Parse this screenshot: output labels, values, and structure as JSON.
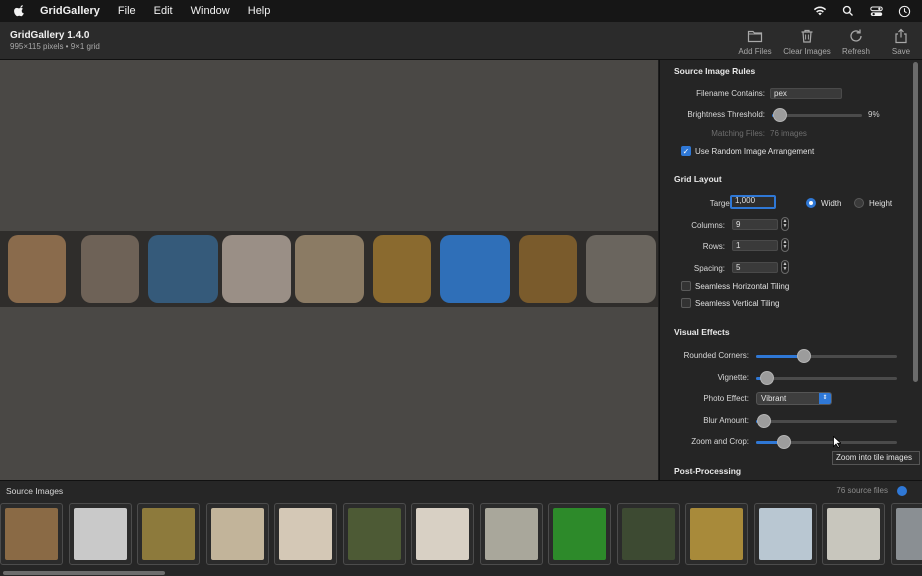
{
  "menubar": {
    "app_name": "GridGallery",
    "items": [
      "File",
      "Edit",
      "Window",
      "Help"
    ]
  },
  "window": {
    "title": "GridGallery 1.4.0",
    "subtitle": "995×115 pixels • 9×1 grid",
    "toolbar": {
      "add_files": "Add Files",
      "clear_images": "Clear Images",
      "refresh": "Refresh",
      "save": "Save"
    }
  },
  "grid_tiles": [
    {
      "icon": "fawn-photo",
      "color": "#8a6b4c"
    },
    {
      "icon": "kittens-photo",
      "color": "#6e6257"
    },
    {
      "icon": "chipmunk-photo",
      "color": "#355a7a"
    },
    {
      "icon": "bluebird-photo",
      "color": "#9a8f86"
    },
    {
      "icon": "hens-photo",
      "color": "#8b7b64"
    },
    {
      "icon": "deer-photo",
      "color": "#8a6a2f"
    },
    {
      "icon": "falcon-photo",
      "color": "#2f6fb8"
    },
    {
      "icon": "rooster-photo",
      "color": "#7a5b2c"
    },
    {
      "icon": "seal-photo",
      "color": "#6a655e"
    }
  ],
  "panel": {
    "source_rules": {
      "heading": "Source Image Rules",
      "filename_label": "Filename Contains:",
      "filename_value": "pex",
      "brightness_label": "Brightness Threshold:",
      "brightness_value": "9%",
      "brightness_level": 0.09,
      "matching_label": "Matching Files:",
      "matching_value": "76 images",
      "random_label": "Use Random Image Arrangement",
      "random_checked": true
    },
    "grid_layout": {
      "heading": "Grid Layout",
      "target_label": "Target Size:",
      "target_value": "1,000",
      "width_label": "Width",
      "height_label": "Height",
      "selected_dimension": "Width",
      "columns_label": "Columns:",
      "columns_value": "9",
      "rows_label": "Rows:",
      "rows_value": "1",
      "spacing_label": "Spacing:",
      "spacing_value": "5",
      "h_tiling_label": "Seamless Horizontal Tiling",
      "v_tiling_label": "Seamless Vertical Tiling"
    },
    "visual_effects": {
      "heading": "Visual Effects",
      "rounded_label": "Rounded Corners:",
      "rounded_level": 0.34,
      "vignette_label": "Vignette:",
      "vignette_level": 0.08,
      "photo_effect_label": "Photo Effect:",
      "photo_effect_value": "Vibrant",
      "blur_label": "Blur Amount:",
      "blur_level": 0.06,
      "zoom_label": "Zoom and Crop:",
      "zoom_level": 0.2
    },
    "post_processing": {
      "heading": "Post-Processing"
    },
    "tooltip": "Zoom into tile images"
  },
  "tray": {
    "title": "Source Images",
    "count": "76 source files",
    "thumbs": [
      {
        "icon": "meerkat-photo",
        "color": "#8a6a45"
      },
      {
        "icon": "penguin-photo",
        "color": "#c9c9c9"
      },
      {
        "icon": "fox-photo",
        "color": "#8d7a3c"
      },
      {
        "icon": "flamingos-photo",
        "color": "#c2b49a"
      },
      {
        "icon": "horse-photo",
        "color": "#d4c8b6"
      },
      {
        "icon": "red-panda-photo",
        "color": "#4d5a35"
      },
      {
        "icon": "owl-photo",
        "color": "#d8d0c4"
      },
      {
        "icon": "geese-photo",
        "color": "#a9a79b"
      },
      {
        "icon": "parrot-photo",
        "color": "#2d8a2a"
      },
      {
        "icon": "raccoon-photo",
        "color": "#3d4a32"
      },
      {
        "icon": "crane-photo",
        "color": "#a88a3a"
      },
      {
        "icon": "lamb-photo",
        "color": "#b9c7d2"
      },
      {
        "icon": "pony-photo",
        "color": "#c8c6bd"
      },
      {
        "icon": "elephant-photo",
        "color": "#8a8f93"
      }
    ]
  }
}
